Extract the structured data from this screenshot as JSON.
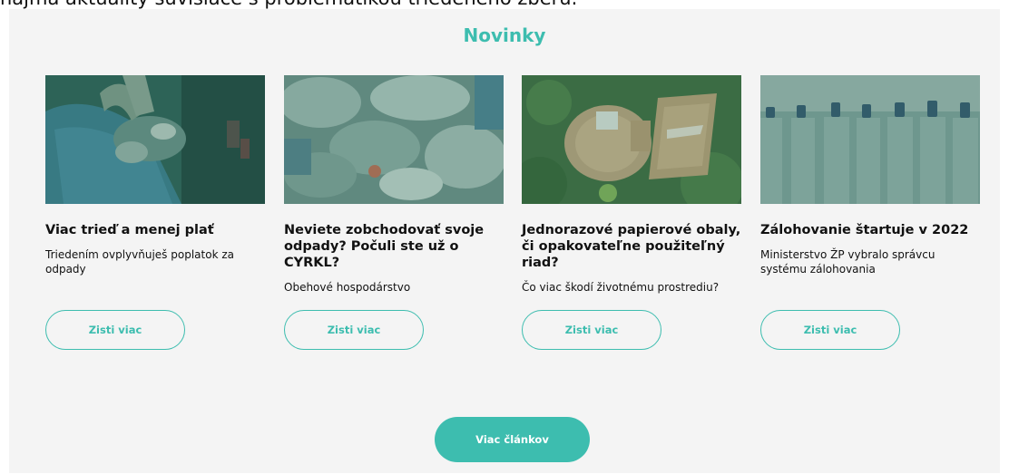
{
  "top_strip": {
    "text": "najmä aktuality súvisiace s problematikou triedeného zberu."
  },
  "section": {
    "title": "Novinky",
    "accent_color": "#3dbdaf"
  },
  "cards": [
    {
      "image": "waste-sorting-photo",
      "title": "Viac trieď a menej plať",
      "subtitle": "Triedením ovplyvňuješ poplatok za odpady",
      "button_label": "Zisti viac"
    },
    {
      "image": "plastic-waste-photo",
      "title": "Neviete zobchodovať svoje odpady? Počuli ste už o CYRKL?",
      "subtitle": "Obehové hospodárstvo",
      "button_label": "Zisti viac"
    },
    {
      "image": "paper-tableware-on-grass-photo",
      "title": "Jednorazové papierové obaly, či opakovateľne použiteľný riad?",
      "subtitle": "Čo viac škodí životnému prostrediu?",
      "button_label": "Zisti viac"
    },
    {
      "image": "plastic-bottles-photo",
      "title": "Zálohovanie štartuje v 2022",
      "subtitle": "Ministerstvo ŽP vybralo správcu systému zálohovania",
      "button_label": "Zisti viac"
    }
  ],
  "more_button": {
    "label": "Viac článkov"
  }
}
